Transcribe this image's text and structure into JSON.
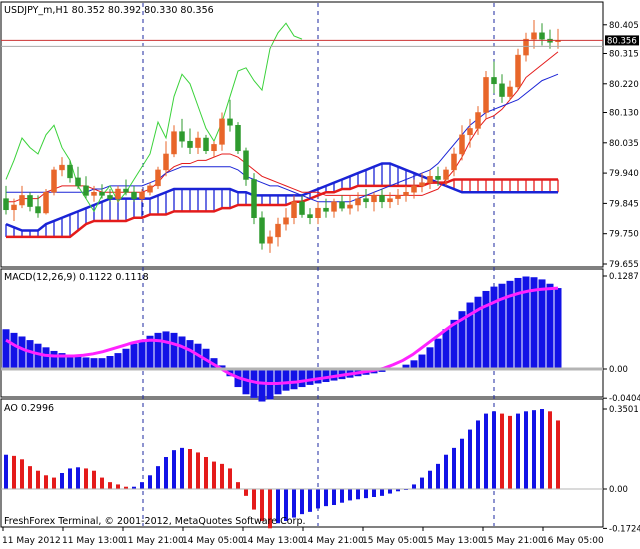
{
  "colors": {
    "bull": "#e8662a",
    "bear": "#2e9a2e",
    "kumo_up": "#1a23d6",
    "kumo_dn": "#e41b1b",
    "tenkan": "#e41b1b",
    "kijun": "#1a23d6",
    "chikou": "#3ad23a",
    "macd_hist": "#1212e6",
    "macd_signal": "#ff22ff",
    "ao_up": "#1212e6",
    "ao_dn": "#e41b1b",
    "bid": "#cc3333",
    "ask": "#aaaaaa",
    "vline": "#1c2aa0"
  },
  "main": {
    "header": "USDJPY_m,H1  80.352 80.392 80.330 80.356",
    "price_badge": "80.356",
    "y_ticks": [
      "80.405",
      "80.315",
      "80.220",
      "80.130",
      "80.035",
      "79.940",
      "79.845",
      "79.750",
      "79.655"
    ]
  },
  "macd": {
    "header": "MACD(12,26,9) 0.1122 0.1118",
    "y_ticks": [
      "0.1287",
      "0.00",
      "-0.0404"
    ]
  },
  "ao": {
    "header": "AO 0.2996",
    "y_ticks": [
      "0.3501",
      "0.00",
      "-0.1724"
    ]
  },
  "x_ticks": [
    "11 May 2012",
    "11 May 13:00",
    "11 May 21:00",
    "14 May 05:00",
    "14 May 13:00",
    "14 May 21:00",
    "15 May 05:00",
    "15 May 13:00",
    "15 May 21:00",
    "16 May 05:00"
  ],
  "copyright": "FreshForex Terminal, © 2001-2012, MetaQuotes Software Corp.",
  "chart_data": {
    "type": "candlestick",
    "symbol": "USDJPY_m",
    "timeframe": "H1",
    "ohlc_current": {
      "open": 80.352,
      "high": 80.392,
      "low": 80.33,
      "close": 80.356
    },
    "bid": 80.356,
    "ylim": [
      79.655,
      80.42
    ],
    "candles": [
      [
        79.86,
        79.9,
        79.81,
        79.825
      ],
      [
        79.825,
        79.86,
        79.79,
        79.84
      ],
      [
        79.84,
        79.9,
        79.83,
        79.87
      ],
      [
        79.87,
        79.88,
        79.82,
        79.835
      ],
      [
        79.835,
        79.87,
        79.8,
        79.815
      ],
      [
        79.815,
        79.89,
        79.81,
        79.88
      ],
      [
        79.88,
        79.96,
        79.87,
        79.95
      ],
      [
        79.95,
        79.99,
        79.93,
        79.965
      ],
      [
        79.965,
        79.98,
        79.91,
        79.925
      ],
      [
        79.925,
        79.96,
        79.89,
        79.9
      ],
      [
        79.9,
        79.93,
        79.86,
        79.87
      ],
      [
        79.87,
        79.9,
        79.85,
        79.88
      ],
      [
        79.88,
        79.905,
        79.86,
        79.87
      ],
      [
        79.87,
        79.89,
        79.85,
        79.86
      ],
      [
        79.86,
        79.9,
        79.85,
        79.89
      ],
      [
        79.89,
        79.92,
        79.87,
        79.88
      ],
      [
        79.88,
        79.9,
        79.85,
        79.86
      ],
      [
        79.86,
        79.89,
        79.85,
        79.88
      ],
      [
        79.88,
        79.91,
        79.87,
        79.9
      ],
      [
        79.9,
        79.96,
        79.89,
        79.95
      ],
      [
        79.95,
        80.04,
        79.93,
        80.0
      ],
      [
        80.0,
        80.09,
        79.99,
        80.07
      ],
      [
        80.07,
        80.11,
        80.02,
        80.04
      ],
      [
        80.04,
        80.08,
        80.0,
        80.02
      ],
      [
        80.02,
        80.07,
        80.0,
        80.05
      ],
      [
        80.05,
        80.06,
        80.0,
        80.01
      ],
      [
        80.01,
        80.04,
        79.99,
        80.03
      ],
      [
        80.03,
        80.13,
        80.01,
        80.11
      ],
      [
        80.11,
        80.17,
        80.07,
        80.09
      ],
      [
        80.09,
        80.1,
        80.0,
        80.01
      ],
      [
        80.01,
        80.02,
        79.9,
        79.92
      ],
      [
        79.92,
        79.94,
        79.78,
        79.8
      ],
      [
        79.8,
        79.82,
        79.7,
        79.72
      ],
      [
        79.72,
        79.76,
        79.69,
        79.74
      ],
      [
        79.74,
        79.8,
        79.71,
        79.78
      ],
      [
        79.78,
        79.83,
        79.76,
        79.8
      ],
      [
        79.8,
        79.87,
        79.78,
        79.85
      ],
      [
        79.85,
        79.87,
        79.8,
        79.81
      ],
      [
        79.81,
        79.83,
        79.78,
        79.8
      ],
      [
        79.8,
        79.85,
        79.78,
        79.83
      ],
      [
        79.83,
        79.86,
        79.8,
        79.82
      ],
      [
        79.82,
        79.86,
        79.8,
        79.85
      ],
      [
        79.85,
        79.87,
        79.82,
        79.83
      ],
      [
        79.83,
        79.87,
        79.81,
        79.84
      ],
      [
        79.84,
        79.88,
        79.82,
        79.86
      ],
      [
        79.86,
        79.89,
        79.83,
        79.85
      ],
      [
        79.85,
        79.88,
        79.82,
        79.87
      ],
      [
        79.87,
        79.89,
        79.83,
        79.85
      ],
      [
        79.85,
        79.88,
        79.83,
        79.86
      ],
      [
        79.86,
        79.89,
        79.84,
        79.87
      ],
      [
        79.87,
        79.9,
        79.85,
        79.88
      ],
      [
        79.88,
        79.92,
        79.86,
        79.9
      ],
      [
        79.9,
        79.94,
        79.88,
        79.91
      ],
      [
        79.91,
        79.95,
        79.89,
        79.93
      ],
      [
        79.93,
        79.96,
        79.9,
        79.92
      ],
      [
        79.92,
        79.96,
        79.9,
        79.95
      ],
      [
        79.95,
        80.02,
        79.93,
        80.0
      ],
      [
        80.0,
        80.09,
        79.98,
        80.06
      ],
      [
        80.06,
        80.11,
        80.02,
        80.08
      ],
      [
        80.08,
        80.15,
        80.06,
        80.13
      ],
      [
        80.13,
        80.26,
        80.11,
        80.24
      ],
      [
        80.24,
        80.29,
        80.19,
        80.22
      ],
      [
        80.22,
        80.25,
        80.16,
        80.18
      ],
      [
        80.18,
        80.23,
        80.17,
        80.21
      ],
      [
        80.21,
        80.33,
        80.2,
        80.31
      ],
      [
        80.31,
        80.38,
        80.29,
        80.36
      ],
      [
        80.36,
        80.42,
        80.33,
        80.38
      ],
      [
        80.38,
        80.41,
        80.34,
        80.36
      ],
      [
        80.36,
        80.39,
        80.33,
        80.35
      ],
      [
        80.352,
        80.392,
        80.33,
        80.356
      ]
    ],
    "tenkan": [
      79.85,
      79.85,
      79.86,
      79.86,
      79.86,
      79.88,
      79.89,
      79.9,
      79.9,
      79.9,
      79.9,
      79.89,
      79.88,
      79.88,
      79.88,
      79.88,
      79.88,
      79.88,
      79.89,
      79.91,
      79.94,
      79.96,
      79.97,
      79.97,
      79.98,
      79.98,
      79.99,
      80.0,
      80.0,
      79.99,
      79.97,
      79.95,
      79.93,
      79.92,
      79.91,
      79.9,
      79.89,
      79.88,
      79.88,
      79.88,
      79.87,
      79.87,
      79.87,
      79.87,
      79.87,
      79.87,
      79.87,
      79.87,
      79.87,
      79.87,
      79.87,
      79.87,
      79.87,
      79.88,
      79.89,
      79.92,
      79.95,
      79.99,
      80.04,
      80.08,
      80.11,
      80.12,
      80.14,
      80.17,
      80.2,
      80.24,
      80.26,
      80.28,
      80.3,
      80.32
    ],
    "kijun": [
      79.88,
      79.88,
      79.88,
      79.88,
      79.88,
      79.88,
      79.88,
      79.88,
      79.88,
      79.88,
      79.88,
      79.89,
      79.89,
      79.9,
      79.9,
      79.9,
      79.9,
      79.9,
      79.91,
      79.92,
      79.94,
      79.95,
      79.96,
      79.96,
      79.96,
      79.96,
      79.96,
      79.96,
      79.96,
      79.95,
      79.93,
      79.92,
      79.91,
      79.9,
      79.9,
      79.89,
      79.88,
      79.87,
      79.86,
      79.85,
      79.85,
      79.85,
      79.85,
      79.85,
      79.86,
      79.87,
      79.88,
      79.89,
      79.9,
      79.91,
      79.92,
      79.93,
      79.94,
      79.95,
      79.97,
      80.0,
      80.03,
      80.06,
      80.09,
      80.11,
      80.13,
      80.14,
      80.15,
      80.16,
      80.17,
      80.19,
      80.21,
      80.23,
      80.24,
      80.25
    ],
    "senkou_a": [
      79.78,
      79.77,
      79.76,
      79.76,
      79.76,
      79.78,
      79.79,
      79.8,
      79.81,
      79.82,
      79.83,
      79.84,
      79.85,
      79.86,
      79.86,
      79.86,
      79.86,
      79.86,
      79.86,
      79.87,
      79.88,
      79.89,
      79.89,
      79.89,
      79.89,
      79.89,
      79.89,
      79.89,
      79.89,
      79.88,
      79.88,
      79.87,
      79.87,
      79.87,
      79.87,
      79.87,
      79.87,
      79.87,
      79.88,
      79.89,
      79.9,
      79.91,
      79.92,
      79.93,
      79.94,
      79.95,
      79.96,
      79.97,
      79.97,
      79.96,
      79.95,
      79.94,
      79.93,
      79.92,
      79.91,
      79.9,
      79.89,
      79.88,
      79.88,
      79.88,
      79.88,
      79.88,
      79.88,
      79.88,
      79.88,
      79.88,
      79.88,
      79.88,
      79.88,
      79.88
    ],
    "senkou_b": [
      79.74,
      79.74,
      79.74,
      79.74,
      79.74,
      79.74,
      79.74,
      79.74,
      79.74,
      79.76,
      79.78,
      79.79,
      79.79,
      79.79,
      79.79,
      79.79,
      79.8,
      79.8,
      79.81,
      79.81,
      79.81,
      79.82,
      79.82,
      79.82,
      79.82,
      79.82,
      79.82,
      79.83,
      79.83,
      79.84,
      79.84,
      79.84,
      79.84,
      79.84,
      79.84,
      79.84,
      79.85,
      79.85,
      79.86,
      79.87,
      79.88,
      79.88,
      79.89,
      79.89,
      79.9,
      79.9,
      79.9,
      79.9,
      79.9,
      79.9,
      79.9,
      79.9,
      79.9,
      79.91,
      79.91,
      79.91,
      79.92,
      79.92,
      79.92,
      79.92,
      79.92,
      79.92,
      79.92,
      79.92,
      79.92,
      79.92,
      79.92,
      79.92,
      79.92,
      79.92
    ],
    "chikou": [
      79.92,
      79.98,
      80.05,
      80.02,
      80.0,
      80.06,
      80.09,
      80.02,
      79.98,
      79.9,
      79.86,
      79.82,
      79.87,
      79.9,
      79.85,
      79.88,
      79.92,
      79.96,
      80.0,
      80.1,
      80.05,
      80.18,
      80.25,
      80.22,
      80.15,
      80.08,
      80.04,
      80.1,
      80.18,
      80.26,
      80.27,
      80.23,
      80.2,
      80.33,
      80.38,
      80.41,
      80.37,
      80.36
    ],
    "macd_hist": [
      0.055,
      0.05,
      0.045,
      0.04,
      0.035,
      0.03,
      0.025,
      0.022,
      0.02,
      0.018,
      0.016,
      0.015,
      0.015,
      0.018,
      0.022,
      0.028,
      0.035,
      0.04,
      0.046,
      0.05,
      0.052,
      0.05,
      0.045,
      0.04,
      0.035,
      0.028,
      0.015,
      0.005,
      -0.01,
      -0.025,
      -0.035,
      -0.04,
      -0.045,
      -0.042,
      -0.035,
      -0.03,
      -0.028,
      -0.025,
      -0.022,
      -0.02,
      -0.018,
      -0.016,
      -0.014,
      -0.012,
      -0.01,
      -0.008,
      -0.006,
      -0.004,
      -0.002,
      0.002,
      0.006,
      0.012,
      0.02,
      0.03,
      0.042,
      0.055,
      0.068,
      0.08,
      0.092,
      0.1,
      0.108,
      0.114,
      0.118,
      0.122,
      0.126,
      0.128,
      0.127,
      0.124,
      0.118,
      0.112
    ],
    "macd_signal": [
      0.04,
      0.032,
      0.026,
      0.022,
      0.019,
      0.018,
      0.018,
      0.018,
      0.019,
      0.021,
      0.024,
      0.028,
      0.032,
      0.036,
      0.039,
      0.04,
      0.039,
      0.036,
      0.032,
      0.026,
      0.018,
      0.01,
      0.002,
      -0.006,
      -0.012,
      -0.016,
      -0.019,
      -0.02,
      -0.02,
      -0.019,
      -0.018,
      -0.016,
      -0.014,
      -0.012,
      -0.01,
      -0.008,
      -0.006,
      -0.004,
      -0.002,
      0.001,
      0.006,
      0.012,
      0.02,
      0.03,
      0.04,
      0.05,
      0.06,
      0.068,
      0.076,
      0.084,
      0.09,
      0.096,
      0.101,
      0.105,
      0.108,
      0.11,
      0.111,
      0.112
    ],
    "ao": [
      0.15,
      0.145,
      0.13,
      0.1,
      0.08,
      0.06,
      0.05,
      0.07,
      0.09,
      0.095,
      0.09,
      0.08,
      0.05,
      0.03,
      0.02,
      0.01,
      0.01,
      0.03,
      0.06,
      0.1,
      0.14,
      0.17,
      0.18,
      0.175,
      0.16,
      0.14,
      0.12,
      0.11,
      0.09,
      0.03,
      -0.03,
      -0.09,
      -0.14,
      -0.172,
      -0.15,
      -0.14,
      -0.125,
      -0.11,
      -0.1,
      -0.085,
      -0.075,
      -0.07,
      -0.06,
      -0.05,
      -0.045,
      -0.04,
      -0.035,
      -0.03,
      -0.02,
      -0.01,
      0.0,
      0.02,
      0.05,
      0.08,
      0.11,
      0.15,
      0.18,
      0.22,
      0.26,
      0.3,
      0.33,
      0.34,
      0.33,
      0.32,
      0.33,
      0.34,
      0.345,
      0.35,
      0.34,
      0.3
    ]
  }
}
